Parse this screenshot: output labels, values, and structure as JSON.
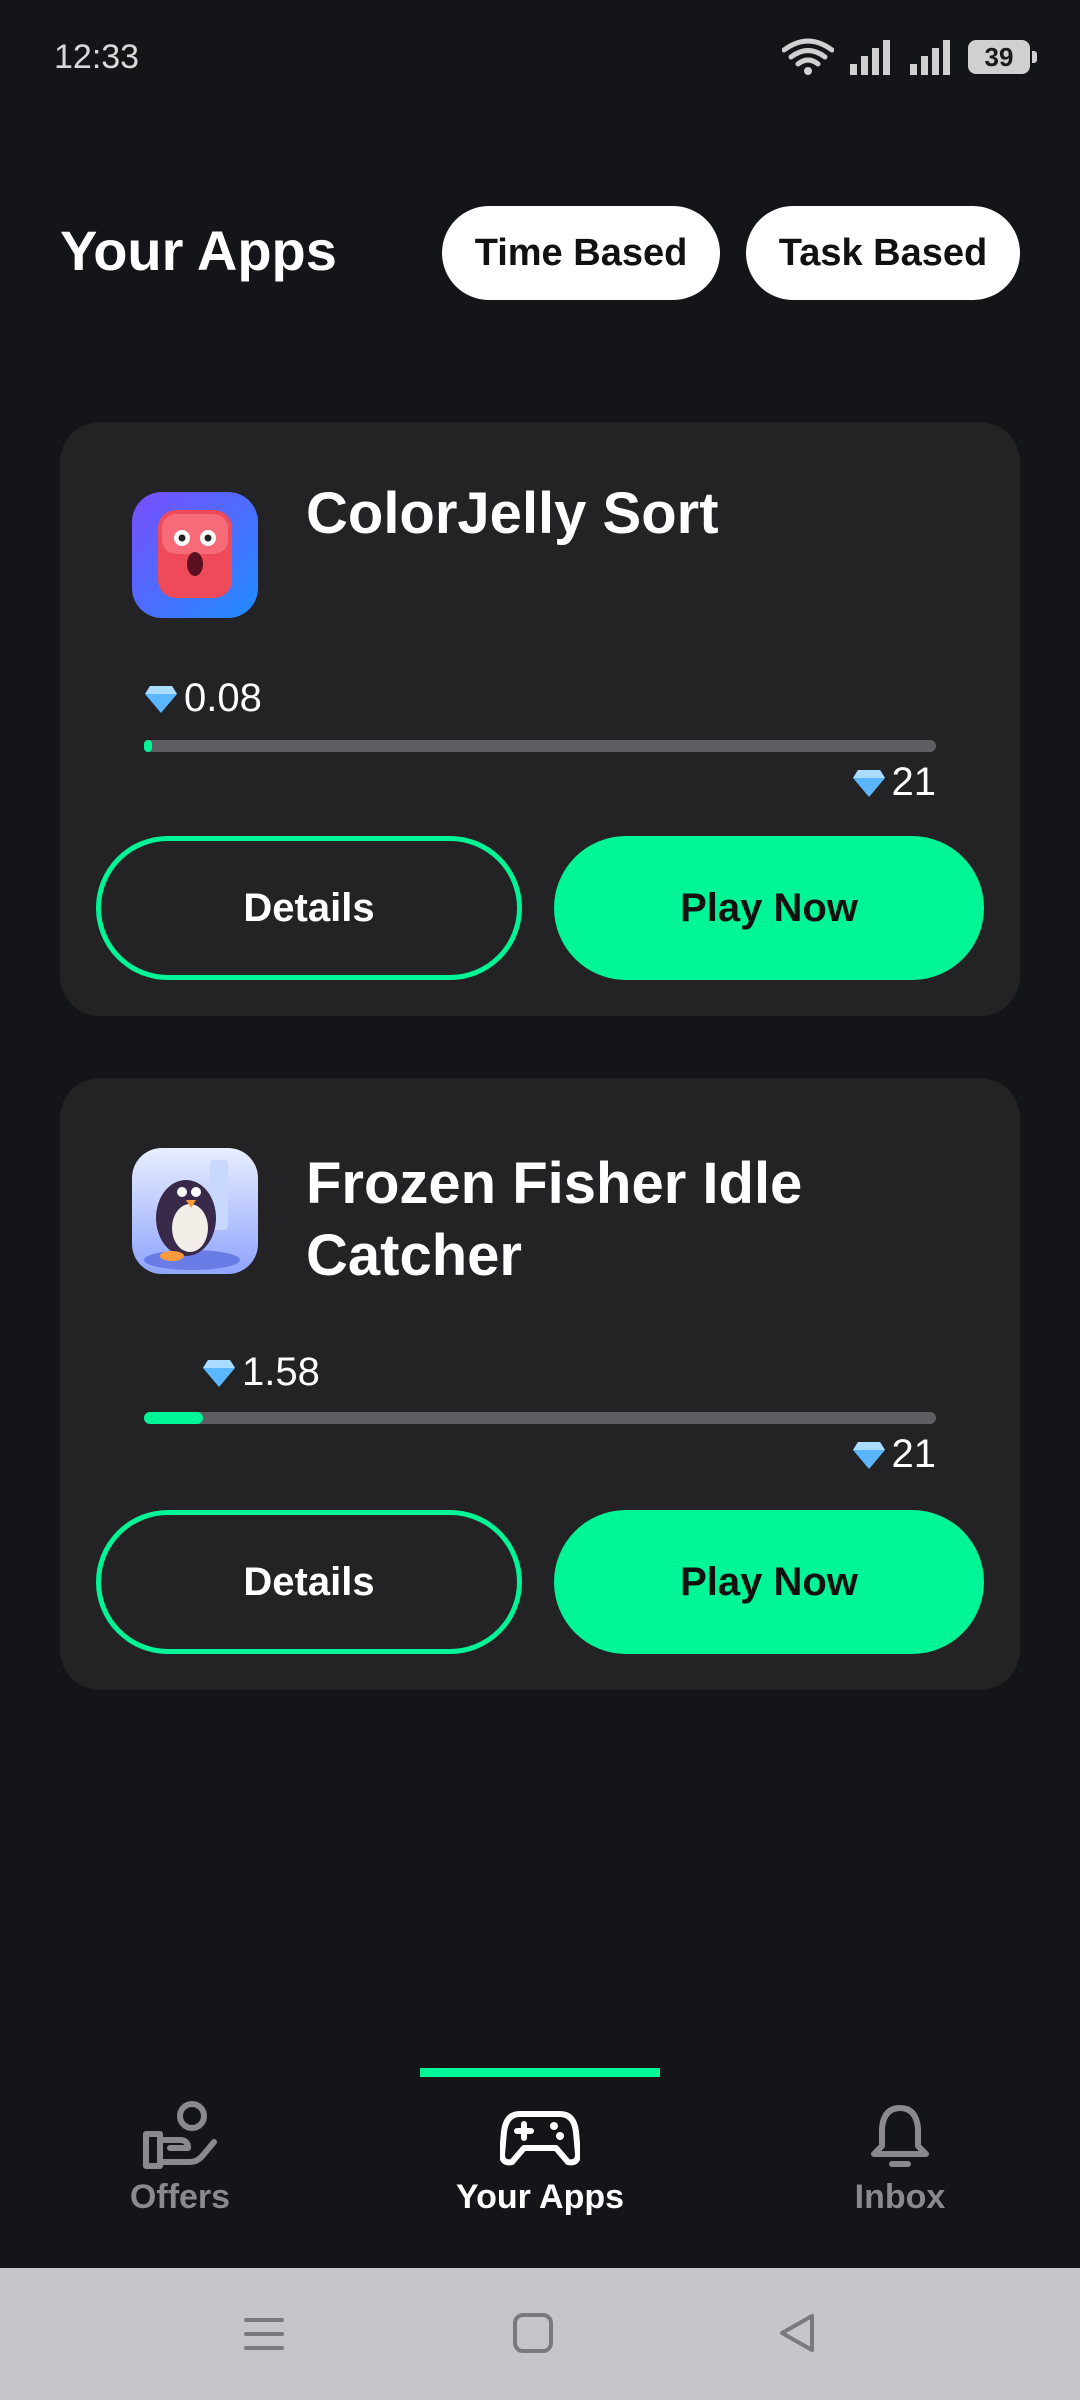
{
  "status_bar": {
    "time": "12:33",
    "battery": "39"
  },
  "header": {
    "title": "Your Apps",
    "filters": [
      "Time Based",
      "Task Based"
    ]
  },
  "apps": [
    {
      "name": "ColorJelly Sort",
      "earned": "0.08",
      "target": "21",
      "progress": 0.0038,
      "details_label": "Details",
      "play_label": "Play Now"
    },
    {
      "name": "Frozen Fisher Idle Catcher",
      "earned": "1.58",
      "target": "21",
      "progress": 0.075,
      "details_label": "Details",
      "play_label": "Play Now"
    }
  ],
  "bottom_nav": {
    "items": [
      {
        "label": "Offers",
        "icon": "offers-hand-icon",
        "active": false
      },
      {
        "label": "Your Apps",
        "icon": "gamepad-icon",
        "active": true
      },
      {
        "label": "Inbox",
        "icon": "bell-icon",
        "active": false
      }
    ]
  },
  "colors": {
    "accent": "#00f596",
    "background": "#141518",
    "card": "#232326",
    "inactive": "#8a8a8e"
  }
}
